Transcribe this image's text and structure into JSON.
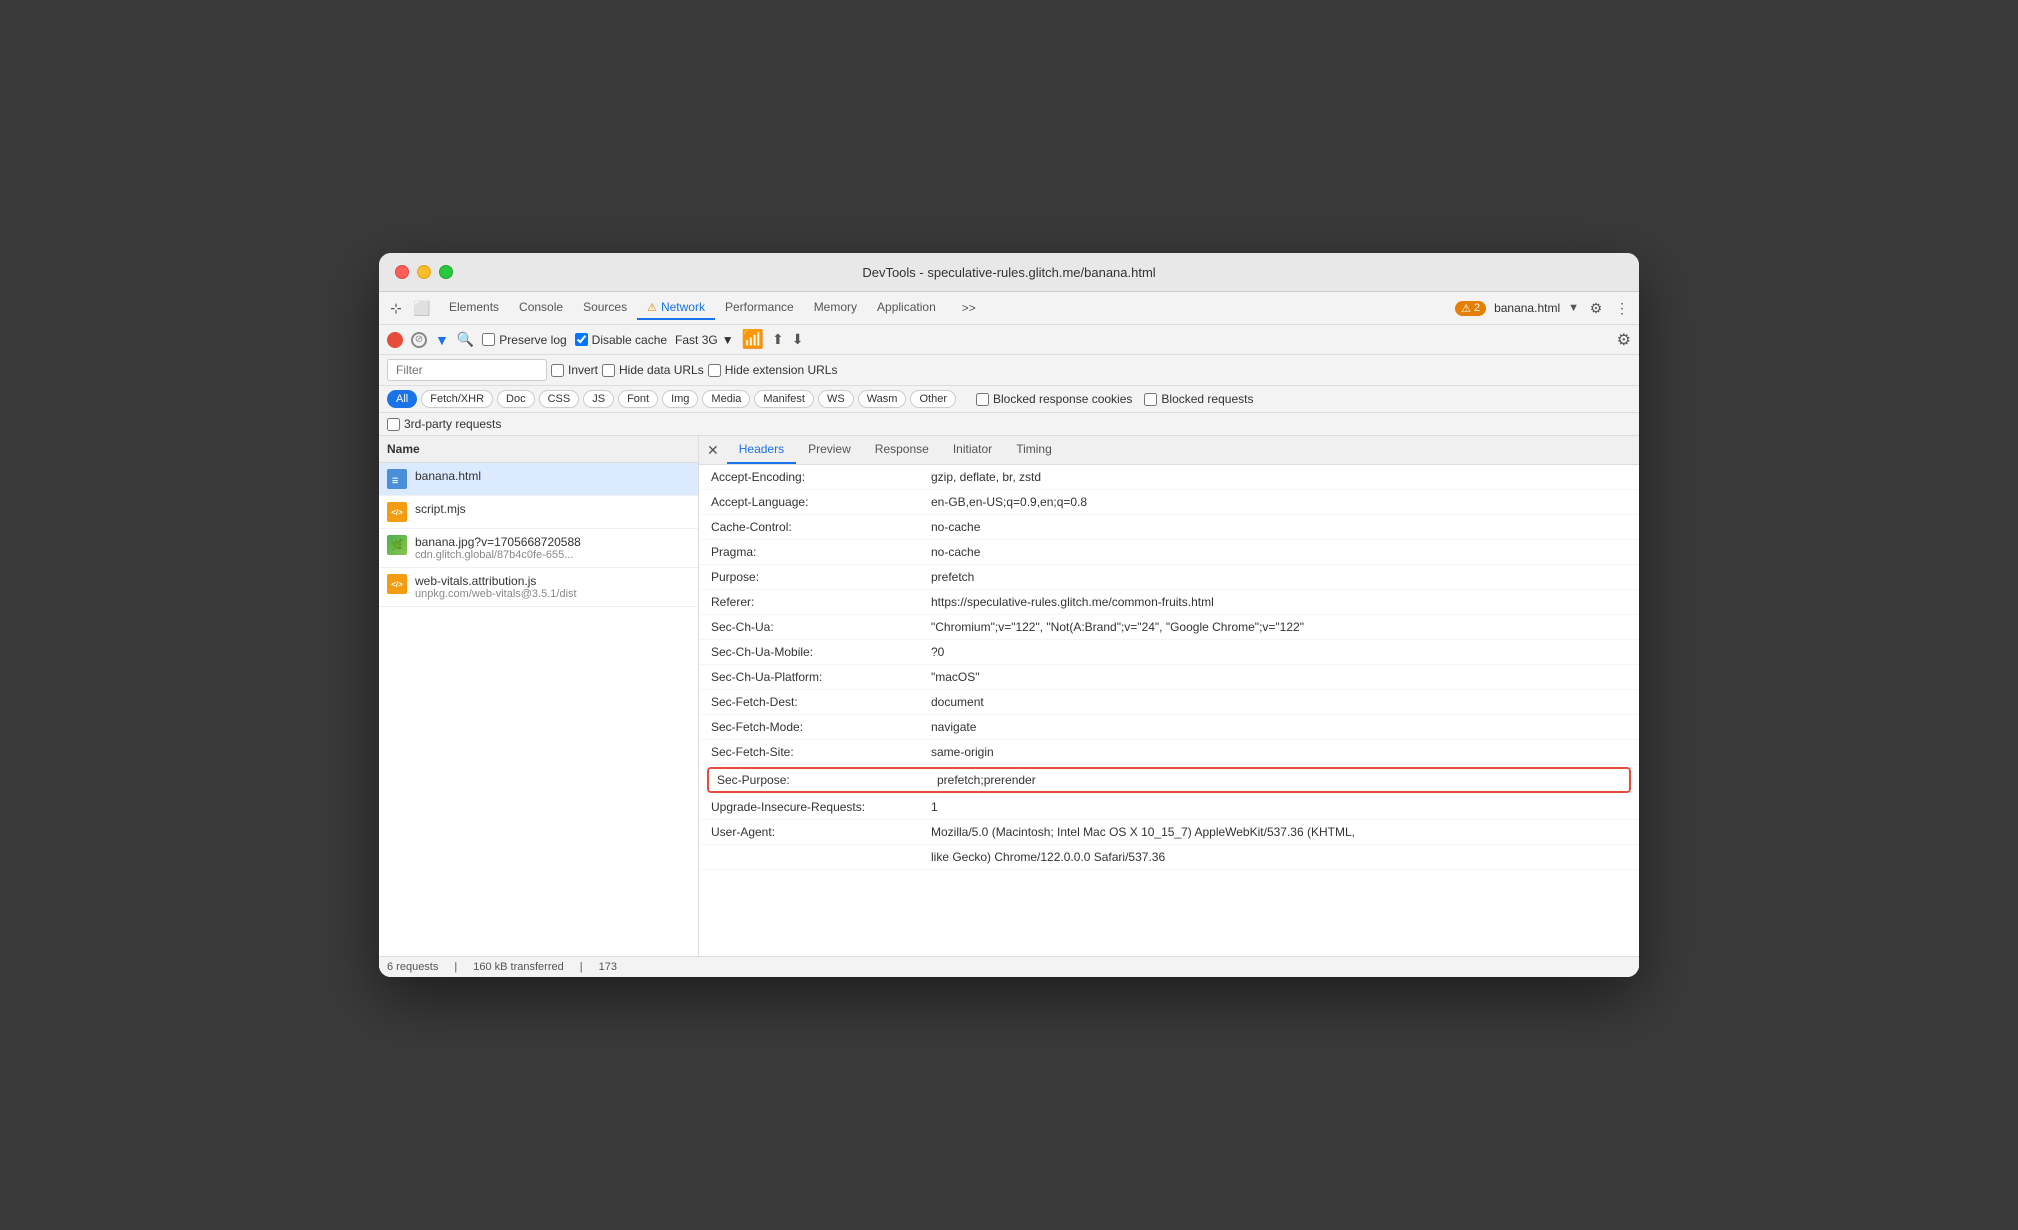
{
  "window": {
    "title": "DevTools - speculative-rules.glitch.me/banana.html"
  },
  "toolbar": {
    "tabs": [
      {
        "id": "elements",
        "label": "Elements",
        "active": false
      },
      {
        "id": "console",
        "label": "Console",
        "active": false
      },
      {
        "id": "sources",
        "label": "Sources",
        "active": false
      },
      {
        "id": "network",
        "label": "Network",
        "active": true,
        "warning": true
      },
      {
        "id": "performance",
        "label": "Performance",
        "active": false
      },
      {
        "id": "memory",
        "label": "Memory",
        "active": false
      },
      {
        "id": "application",
        "label": "Application",
        "active": false
      }
    ],
    "more_tabs_icon": ">>",
    "badge_icon": "⚠",
    "badge_count": "2",
    "current_page": "banana.html",
    "settings_icon": "⚙",
    "more_options_icon": "⋮"
  },
  "network_toolbar": {
    "preserve_log": "Preserve log",
    "disable_cache": "Disable cache",
    "throttle": "Fast 3G",
    "invert_label": "Invert",
    "hide_data_urls": "Hide data URLs",
    "hide_extension_urls": "Hide extension URLs"
  },
  "filter_buttons": [
    {
      "id": "all",
      "label": "All",
      "active": true
    },
    {
      "id": "fetch",
      "label": "Fetch/XHR",
      "active": false
    },
    {
      "id": "doc",
      "label": "Doc",
      "active": false
    },
    {
      "id": "css",
      "label": "CSS",
      "active": false
    },
    {
      "id": "js",
      "label": "JS",
      "active": false
    },
    {
      "id": "font",
      "label": "Font",
      "active": false
    },
    {
      "id": "img",
      "label": "Img",
      "active": false
    },
    {
      "id": "media",
      "label": "Media",
      "active": false
    },
    {
      "id": "manifest",
      "label": "Manifest",
      "active": false
    },
    {
      "id": "ws",
      "label": "WS",
      "active": false
    },
    {
      "id": "wasm",
      "label": "Wasm",
      "active": false
    },
    {
      "id": "other",
      "label": "Other",
      "active": false
    }
  ],
  "checkboxes": {
    "blocked_response_cookies": "Blocked response cookies",
    "blocked_requests": "Blocked requests",
    "third_party": "3rd-party requests"
  },
  "filter_placeholder": "Filter",
  "left_panel": {
    "column_header": "Name",
    "files": [
      {
        "id": "banana-html",
        "name": "banana.html",
        "subtitle": "",
        "type": "html",
        "icon": "☰",
        "selected": true
      },
      {
        "id": "script-mjs",
        "name": "script.mjs",
        "subtitle": "",
        "type": "js",
        "icon": "</>",
        "selected": false
      },
      {
        "id": "banana-jpg",
        "name": "banana.jpg?v=1705668720588",
        "subtitle": "cdn.glitch.global/87b4c0fe-655...",
        "type": "img",
        "icon": "🌿",
        "selected": false
      },
      {
        "id": "web-vitals",
        "name": "web-vitals.attribution.js",
        "subtitle": "unpkg.com/web-vitals@3.5.1/dist",
        "type": "js",
        "icon": "</>",
        "selected": false
      }
    ]
  },
  "right_panel": {
    "tabs": [
      {
        "id": "headers",
        "label": "Headers",
        "active": true
      },
      {
        "id": "preview",
        "label": "Preview",
        "active": false
      },
      {
        "id": "response",
        "label": "Response",
        "active": false
      },
      {
        "id": "initiator",
        "label": "Initiator",
        "active": false
      },
      {
        "id": "timing",
        "label": "Timing",
        "active": false
      }
    ],
    "headers": [
      {
        "name": "Accept-Encoding:",
        "value": "gzip, deflate, br, zstd"
      },
      {
        "name": "Accept-Language:",
        "value": "en-GB,en-US;q=0.9,en;q=0.8"
      },
      {
        "name": "Cache-Control:",
        "value": "no-cache"
      },
      {
        "name": "Pragma:",
        "value": "no-cache"
      },
      {
        "name": "Purpose:",
        "value": "prefetch"
      },
      {
        "name": "Referer:",
        "value": "https://speculative-rules.glitch.me/common-fruits.html"
      },
      {
        "name": "Sec-Ch-Ua:",
        "value": "\"Chromium\";v=\"122\", \"Not(A:Brand\";v=\"24\", \"Google Chrome\";v=\"122\""
      },
      {
        "name": "Sec-Ch-Ua-Mobile:",
        "value": "?0"
      },
      {
        "name": "Sec-Ch-Ua-Platform:",
        "value": "\"macOS\""
      },
      {
        "name": "Sec-Fetch-Dest:",
        "value": "document"
      },
      {
        "name": "Sec-Fetch-Mode:",
        "value": "navigate"
      },
      {
        "name": "Sec-Fetch-Site:",
        "value": "same-origin"
      },
      {
        "name": "Sec-Purpose:",
        "value": "prefetch;prerender",
        "highlighted": true
      },
      {
        "name": "Upgrade-Insecure-Requests:",
        "value": "1"
      },
      {
        "name": "User-Agent:",
        "value": "Mozilla/5.0 (Macintosh; Intel Mac OS X 10_15_7) AppleWebKit/537.36 (KHTML,"
      },
      {
        "name": "",
        "value": "like Gecko) Chrome/122.0.0.0 Safari/537.36"
      }
    ]
  },
  "status_bar": {
    "requests": "6 requests",
    "transferred": "160 kB transferred",
    "other": "173"
  }
}
